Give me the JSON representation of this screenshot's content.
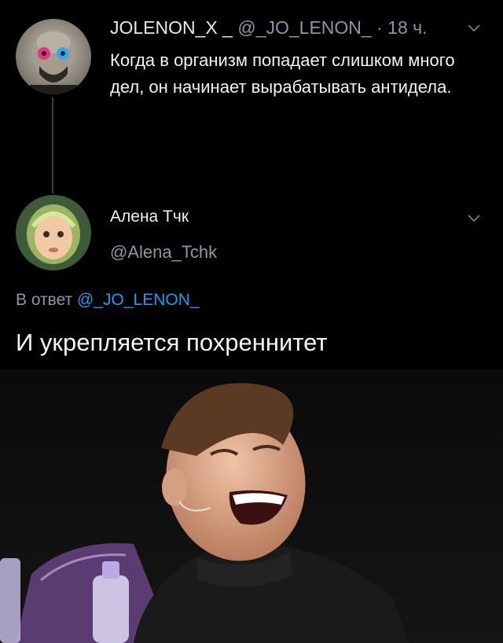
{
  "tweet1": {
    "display_name": "JOLENON_X _",
    "handle": "@_JO_LENON_",
    "separator": "·",
    "time": "18 ч.",
    "text": "Когда в организм попадает слишком много дел, он начинает вырабатывать антидела.",
    "avatar": "avatar-portrait-icon",
    "menu_icon": "chevron-down-icon"
  },
  "tweet2": {
    "display_name": "Алена Тчк",
    "handle": "@Alena_Tchk",
    "reply_prefix": "В ответ",
    "reply_to": "@_JO_LENON_",
    "text": "И укрепляется похреннитет",
    "avatar": "avatar-child-icon",
    "menu_icon": "chevron-down-icon",
    "image": "laughing-man-photo"
  },
  "colors": {
    "background": "#000000",
    "muted": "#8899a6",
    "link": "#1d9bf0",
    "thread_line": "#3a3f45"
  }
}
